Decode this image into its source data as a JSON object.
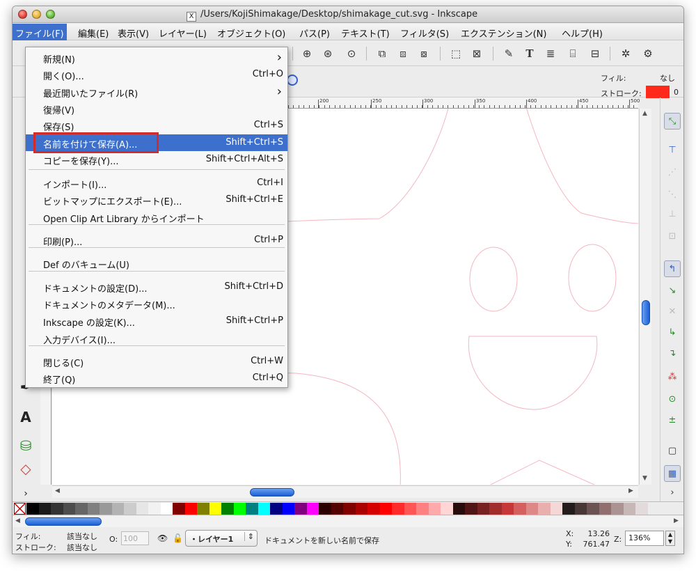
{
  "window": {
    "title": "/Users/KojiShimakage/Desktop/shimakage_cut.svg - Inkscape"
  },
  "menubar": [
    {
      "label": "ファイル(F)",
      "active": true
    },
    {
      "label": "編集(E)"
    },
    {
      "label": "表示(V)"
    },
    {
      "label": "レイヤー(L)"
    },
    {
      "label": "オブジェクト(O)"
    },
    {
      "label": "パス(P)"
    },
    {
      "label": "テキスト(T)"
    },
    {
      "label": "フィルタ(S)"
    },
    {
      "label": "エクステンション(N)"
    },
    {
      "label": "ヘルプ(H)"
    }
  ],
  "file_menu": [
    {
      "label": "新規(N)",
      "shortcut": "",
      "submenu": true
    },
    {
      "label": "開く(O)...",
      "shortcut": "Ctrl+O"
    },
    {
      "label": "最近開いたファイル(R)",
      "shortcut": "",
      "submenu": true
    },
    {
      "label": "復帰(V)",
      "shortcut": ""
    },
    {
      "label": "保存(S)",
      "shortcut": "Ctrl+S"
    },
    {
      "label": "名前を付けて保存(A)...",
      "shortcut": "Shift+Ctrl+S",
      "selected": true
    },
    {
      "label": "コピーを保存(Y)...",
      "shortcut": "Shift+Ctrl+Alt+S"
    },
    {
      "label": "インポート(I)...",
      "shortcut": "Ctrl+I"
    },
    {
      "label": "ビットマップにエクスポート(E)...",
      "shortcut": "Shift+Ctrl+E"
    },
    {
      "label": "Open Clip Art Library からインポート",
      "shortcut": ""
    },
    {
      "label": "印刷(P)...",
      "shortcut": "Ctrl+P"
    },
    {
      "label": "Def のバキューム(U)",
      "shortcut": ""
    },
    {
      "label": "ドキュメントの設定(D)...",
      "shortcut": "Shift+Ctrl+D"
    },
    {
      "label": "ドキュメントのメタデータ(M)...",
      "shortcut": ""
    },
    {
      "label": "Inkscape の設定(K)...",
      "shortcut": "Shift+Ctrl+P"
    },
    {
      "label": "入力デバイス(I)...",
      "shortcut": ""
    },
    {
      "label": "閉じる(C)",
      "shortcut": "Ctrl+W"
    },
    {
      "label": "終了(Q)",
      "shortcut": "Ctrl+Q"
    }
  ],
  "style_indicator": {
    "fill_label": "フィル:",
    "fill_value": "なし",
    "stroke_label": "ストローク:",
    "stroke_color": "#ff2a1a",
    "stroke_width": "0"
  },
  "ruler": {
    "labels": [
      "200",
      "250",
      "300",
      "350",
      "400",
      "450",
      "500"
    ]
  },
  "statusbar": {
    "fill_label": "フィル:",
    "fill_value": "該当なし",
    "stroke_label": "ストローク:",
    "stroke_value": "該当なし",
    "opacity_label": "O:",
    "opacity_value": "100",
    "layer_name": "・レイヤー1",
    "message": "ドキュメントを新しい名前で保存",
    "x_label": "X:",
    "x_value": "13.26",
    "y_label": "Y:",
    "y_value": "761.47",
    "zoom_label": "Z:",
    "zoom_value": "136%"
  },
  "colors": {
    "accent": "#3d6fcc",
    "highlight_border": "#d42a2a",
    "drawing_stroke": "#f4b6c0"
  },
  "palette": [
    "#000000",
    "#1a1a1a",
    "#333333",
    "#4d4d4d",
    "#666666",
    "#808080",
    "#999999",
    "#b3b3b3",
    "#cccccc",
    "#e6e6e6",
    "#f2f2f2",
    "#ffffff",
    "#800000",
    "#ff0000",
    "#808000",
    "#ffff00",
    "#008000",
    "#00ff00",
    "#008080",
    "#00ffff",
    "#000080",
    "#0000ff",
    "#800080",
    "#ff00ff",
    "#2b0000",
    "#550000",
    "#800000",
    "#aa0000",
    "#d40000",
    "#ff0000",
    "#ff2a2a",
    "#ff5555",
    "#ff8080",
    "#ffaaaa",
    "#ffd5d5",
    "#280b0b",
    "#501616",
    "#782121",
    "#a02c2c",
    "#c83737",
    "#d35f5f",
    "#de8787",
    "#e9afaf",
    "#f4d7d7",
    "#241c1c",
    "#483737",
    "#6c5353",
    "#916f6f",
    "#ac9393",
    "#c8b7b7",
    "#e3dbdb"
  ]
}
